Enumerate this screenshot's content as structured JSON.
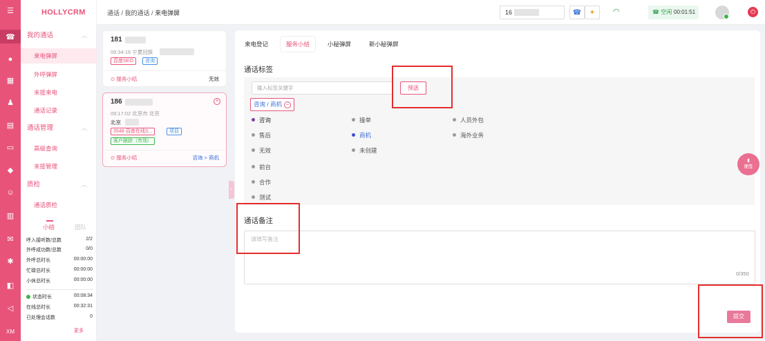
{
  "brand": "HOLLYCRM",
  "rail_icons": [
    "menu-icon",
    "phone-icon",
    "chat-icon",
    "grid-icon",
    "user-icon",
    "document-icon",
    "monitor-icon",
    "shield-icon",
    "robot-icon",
    "bar-chart-icon",
    "message-icon",
    "gear-icon",
    "notification-icon",
    "send-icon"
  ],
  "rail_footer": "XM",
  "sidebar": {
    "groups": [
      {
        "label": "我的通话",
        "items": [
          "来电弹屏",
          "外呼弹屏",
          "未接来电",
          "通话记录"
        ]
      },
      {
        "label": "通话管理",
        "items": [
          "高级查询",
          "未接管理"
        ]
      },
      {
        "label": "质检",
        "items": [
          "通话质检"
        ]
      }
    ]
  },
  "stats": {
    "tabs": [
      "小结",
      "团队"
    ],
    "rows": [
      {
        "label": "呼入接听数/总数",
        "value": "2/2"
      },
      {
        "label": "外呼成功数/总数",
        "value": "0/0"
      },
      {
        "label": "外呼总时长",
        "value": "00:00:00"
      },
      {
        "label": "忙碌总时长",
        "value": "00:00:00"
      },
      {
        "label": "小休总时长",
        "value": "00:00:00"
      }
    ],
    "rows2": [
      {
        "label": "状态时长",
        "value": "00:08:34"
      },
      {
        "label": "在线总时长",
        "value": "00:32:31"
      },
      {
        "label": "已处理会话数",
        "value": "0"
      }
    ],
    "more": "更多"
  },
  "header": {
    "breadcrumb": [
      "通话",
      "我的通话",
      "来电弹屏"
    ],
    "phone_prefix": "16",
    "status": "空闲",
    "timer": "00:01:51"
  },
  "calls": [
    {
      "number": "181",
      "time": "09:34:16 宁夏回族",
      "tags": [
        "百度SEO",
        "咨询"
      ],
      "summary": "服务小结",
      "result": "无效"
    },
    {
      "number": "186",
      "time": "09:17:02 北京市 北京",
      "name": "北京",
      "tags": [
        "3548-百度在线S...",
        "项目",
        "客户跟踪（市场）"
      ],
      "summary": "服务小结",
      "result": "咨询 > 商机"
    }
  ],
  "tabs": [
    "来电登记",
    "服务小结",
    "小秘弹屏",
    "新小秘弹屏"
  ],
  "tag_section": {
    "title": "通话标签",
    "keyword_placeholder": "输入标签关键字",
    "filter_label": "预选",
    "selected": "咨询 / 商机",
    "col1": [
      "咨询",
      "售后",
      "无效",
      "前台",
      "合作",
      "测试"
    ],
    "col2": [
      "撞单",
      "商机",
      "未创建"
    ],
    "col3": [
      "人员外包",
      "海外业务"
    ]
  },
  "memo": {
    "title": "通话备注",
    "placeholder": "请填写备注",
    "count": "0/350"
  },
  "submit_label": "提交",
  "note_fab_label": "便签"
}
